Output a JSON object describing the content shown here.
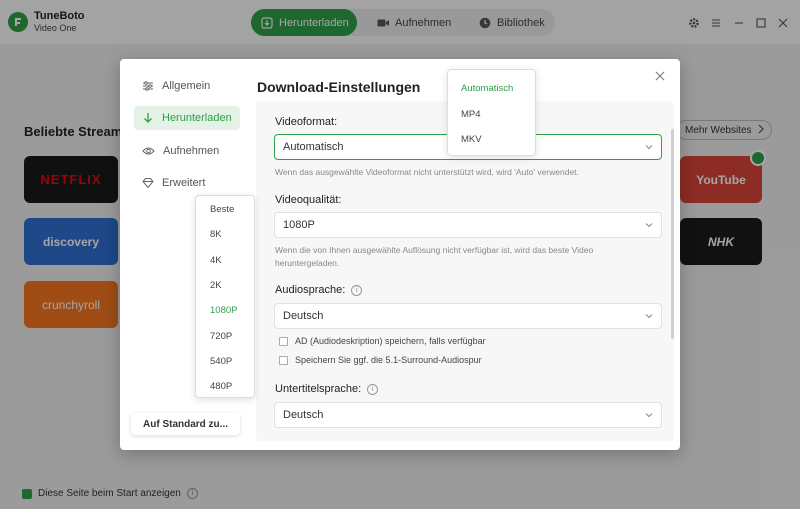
{
  "app": {
    "name": "TuneBoto",
    "subtitle": "Video One",
    "nav": [
      {
        "label": "Herunterladen"
      },
      {
        "label": "Aufnehmen"
      },
      {
        "label": "Bibliothek"
      }
    ]
  },
  "main": {
    "section_title": "Beliebte Stream",
    "more_sites": "Mehr Websites",
    "tiles": [
      {
        "label": "NETFLIX",
        "color": "#e50914"
      },
      {
        "label": "discovery",
        "color": "#2f6fd1"
      },
      {
        "label": "crunchyroll",
        "color": "#f47521"
      },
      {
        "label": "YouTube",
        "color": "#d6d6d6"
      },
      {
        "label": "NHK",
        "color": "#1b1b1b"
      }
    ],
    "startup_label": "Diese Seite beim Start anzeigen"
  },
  "dialog": {
    "title": "Download-Einstellungen",
    "sidebar": [
      {
        "label": "Allgemein"
      },
      {
        "label": "Herunterladen"
      },
      {
        "label": "Aufnehmen"
      },
      {
        "label": "Erweitert"
      }
    ],
    "reset_button": "Auf Standard zu...",
    "video_format": {
      "label": "Videoformat:",
      "value": "Automatisch",
      "hint": "Wenn das ausgewählte Videoformat nicht unterstützt wird, wird 'Auto' verwendet."
    },
    "video_quality": {
      "label": "Videoqualität:",
      "value": "1080P",
      "hint": "Wenn die von Ihnen ausgewählte Auflösung nicht verfügbar ist, wird das beste Video heruntergeladen."
    },
    "audio_language": {
      "label": "Audiosprache:",
      "value": "Deutsch",
      "checkbox1": "AD (Audiodeskription) speichern, falls verfügbar",
      "checkbox2": "Speichern Sie ggf. die 5.1-Surround-Audiospur"
    },
    "subtitle_language": {
      "label": "Untertitelsprache:",
      "value": "Deutsch"
    }
  },
  "format_dropdown": {
    "options": [
      "Automatisch",
      "MP4",
      "MKV"
    ],
    "selected": "Automatisch"
  },
  "quality_dropdown": {
    "options": [
      "Beste",
      "8K",
      "4K",
      "2K",
      "1080P",
      "720P",
      "540P",
      "480P"
    ],
    "selected": "1080P"
  },
  "colors": {
    "accent": "#2e9e47",
    "accent_light": "#e3f2e5"
  }
}
